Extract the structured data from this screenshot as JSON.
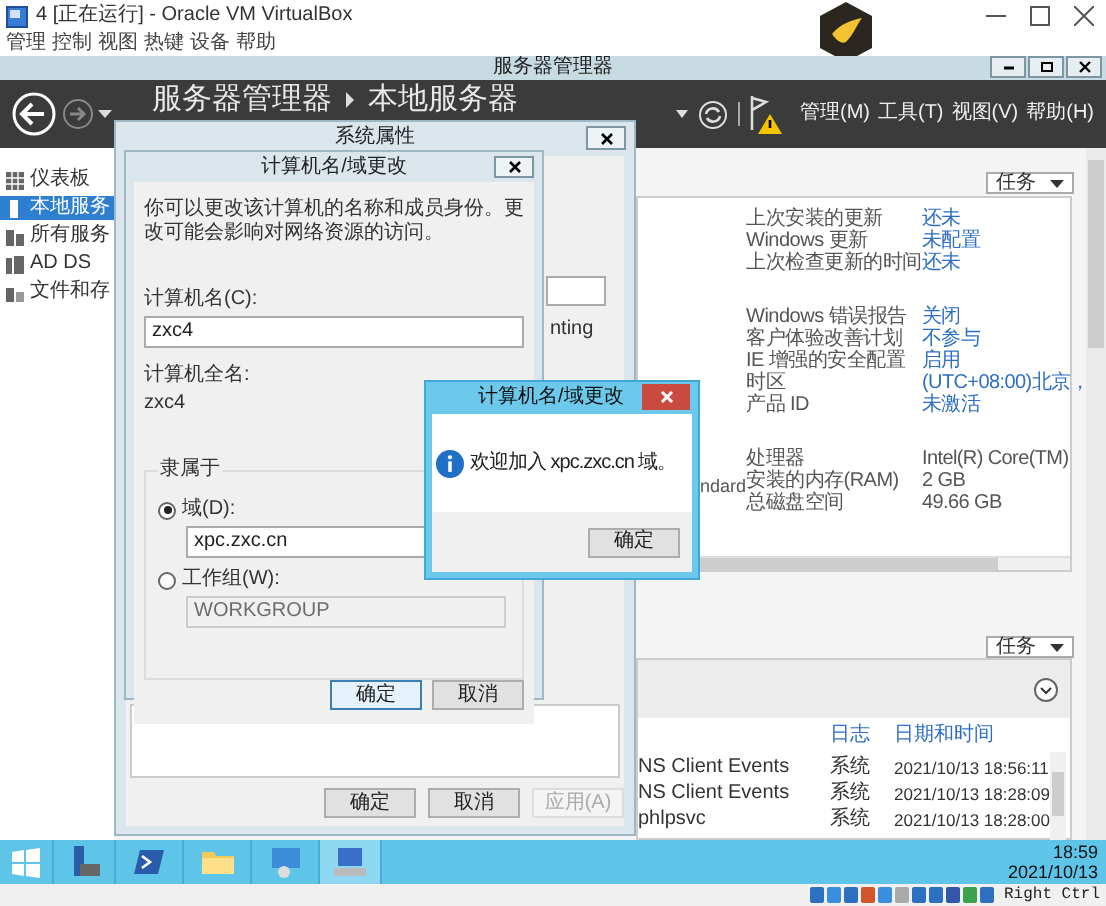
{
  "vbox": {
    "title": "4 [正在运行] - Oracle VM VirtualBox",
    "menu": [
      "管理",
      "控制",
      "视图",
      "热键",
      "设备",
      "帮助"
    ]
  },
  "server_manager": {
    "title": "服务器管理器",
    "breadcrumb": [
      "服务器管理器",
      "本地服务器"
    ],
    "menus": [
      "管理(M)",
      "工具(T)",
      "视图(V)",
      "帮助(H)"
    ],
    "sidebar": [
      {
        "label": "仪表板",
        "selected": false
      },
      {
        "label": "本地服务",
        "selected": true
      },
      {
        "label": "所有服务",
        "selected": false
      },
      {
        "label": "AD DS",
        "selected": false
      },
      {
        "label": "文件和存",
        "selected": false
      }
    ],
    "tasks_buttons": [
      "任务",
      "任务"
    ],
    "property_groups": [
      [
        {
          "label": "上次安装的更新",
          "value": "还未"
        },
        {
          "label": "Windows 更新",
          "value": "未配置"
        },
        {
          "label": "上次检查更新的时间",
          "value": "还未"
        }
      ],
      [
        {
          "label": "Windows 错误报告",
          "value": "关闭"
        },
        {
          "label": "客户体验改善计划",
          "value": "不参与"
        },
        {
          "label": "IE 增强的安全配置",
          "value": "启用"
        },
        {
          "label": "时区",
          "value": "(UTC+08:00)北京，"
        },
        {
          "label": "产品 ID",
          "value": "未激活"
        }
      ],
      [
        {
          "label": "处理器",
          "value": "Intel(R) Core(TM)",
          "plain": true
        },
        {
          "label": "安装的内存(RAM)",
          "value": "2 GB",
          "plain": true
        },
        {
          "label": "总磁盘空间",
          "value": "49.66 GB",
          "plain": true
        }
      ]
    ],
    "partial_text": "ndard",
    "events": {
      "columns": [
        "日志",
        "日期和时间"
      ],
      "rows": [
        {
          "source": "NS Client Events",
          "log": "系统",
          "time": "2021/10/13 18:56:11"
        },
        {
          "source": "NS Client Events",
          "log": "系统",
          "time": "2021/10/13 18:28:09"
        },
        {
          "source": "phlpsvc",
          "log": "系统",
          "time": "2021/10/13 18:28:00"
        }
      ]
    }
  },
  "system_properties": {
    "title": "系统属性",
    "partial_text": "nting",
    "buttons": [
      {
        "label": "确定",
        "disabled": false
      },
      {
        "label": "取消",
        "disabled": false
      },
      {
        "label": "应用(A)",
        "disabled": true
      }
    ]
  },
  "computer_name_dialog": {
    "title": "计算机名/域更改",
    "description": "你可以更改该计算机的名称和成员身份。更改可能会影响对网络资源的访问。",
    "computer_name_label": "计算机名(C):",
    "computer_name": "zxc4",
    "full_name_label": "计算机全名:",
    "full_name": "zxc4",
    "member_of_label": "隶属于",
    "options": [
      {
        "label": "域(D):",
        "value": "xpc.zxc.cn",
        "selected": true
      },
      {
        "label": "工作组(W):",
        "value": "WORKGROUP",
        "selected": false
      }
    ],
    "buttons": [
      "确定",
      "取消"
    ]
  },
  "message_box": {
    "title": "计算机名/域更改",
    "message": "欢迎加入 xpc.zxc.cn 域。",
    "button": "确定"
  },
  "taskbar": {
    "clock": "18:59",
    "date": "2021/10/13"
  },
  "vbox_status": {
    "host_key": "Right Ctrl"
  }
}
